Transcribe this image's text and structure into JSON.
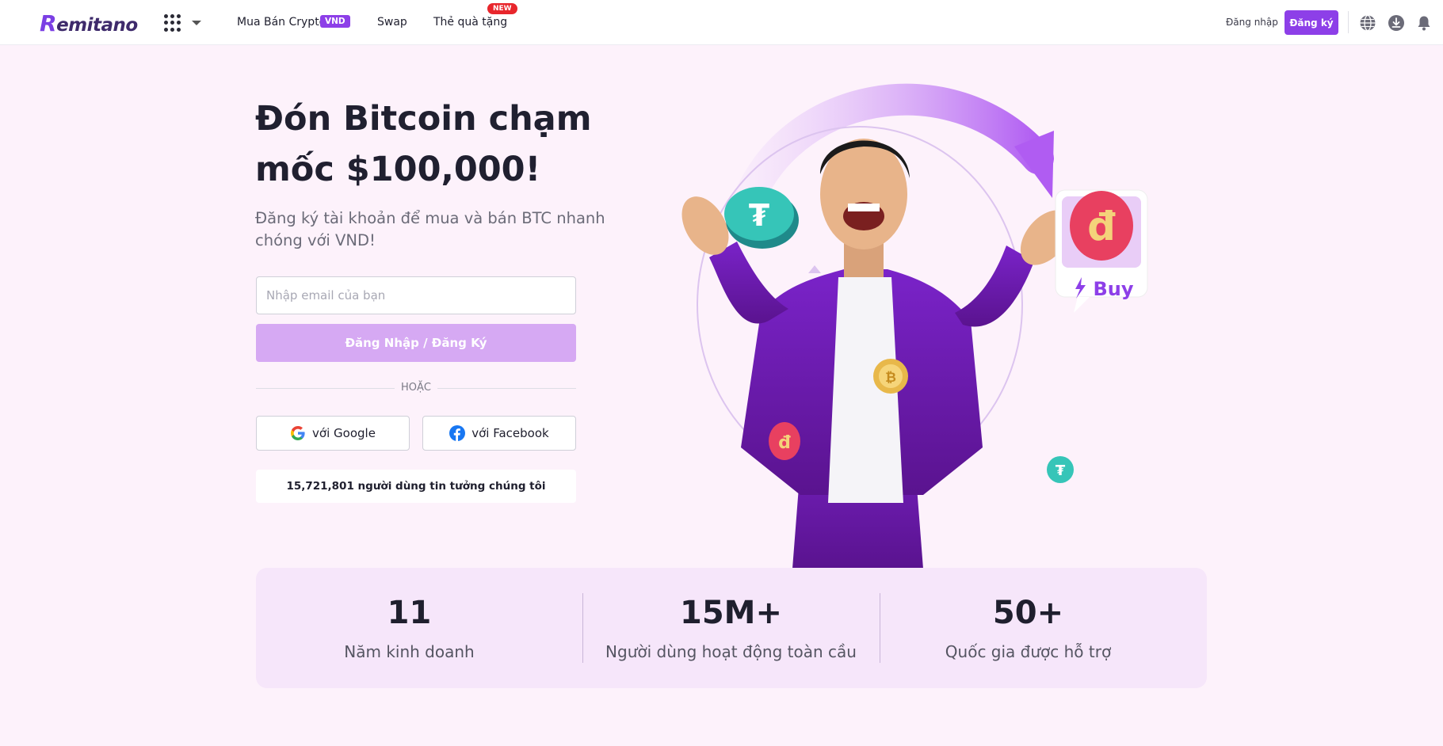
{
  "header": {
    "logo_text": "emitano",
    "logo_initial": "R",
    "nav": [
      {
        "label": "Mua Bán Crypto",
        "badge": "VND"
      },
      {
        "label": "Swap"
      },
      {
        "label": "Thẻ quà tặng",
        "badge": "NEW"
      }
    ],
    "login_label": "Đăng nhập",
    "signup_label": "Đăng ký",
    "icons": [
      "globe-icon",
      "download-icon",
      "bell-icon"
    ]
  },
  "hero": {
    "title": "Đón Bitcoin chạm mốc $100,000!",
    "subtitle": "Đăng ký tài khoản để mua và bán BTC nhanh chóng với VND!",
    "email_placeholder": "Nhập email của bạn",
    "email_value": "",
    "submit_label": "Đăng Nhập / Đăng Ký",
    "or_label": "HOẶC",
    "google_label": "với Google",
    "facebook_label": "với Facebook",
    "trust_text": "15,721,801 người dùng tin tưởng chúng tôi",
    "art_buy_label": "Buy",
    "art_coins": [
      "tether-coin",
      "vnd-coin",
      "bitcoin-coin"
    ]
  },
  "stats": [
    {
      "value": "11",
      "label": "Năm kinh doanh"
    },
    {
      "value": "15M+",
      "label": "Người dùng hoạt động toàn cầu"
    },
    {
      "value": "50+",
      "label": "Quốc gia được hỗ trợ"
    }
  ],
  "colors": {
    "brand_purple": "#8d3fe8",
    "page_bg": "#fdf2fb",
    "stats_bg": "#f6e6fa",
    "new_badge": "#e8262c"
  }
}
